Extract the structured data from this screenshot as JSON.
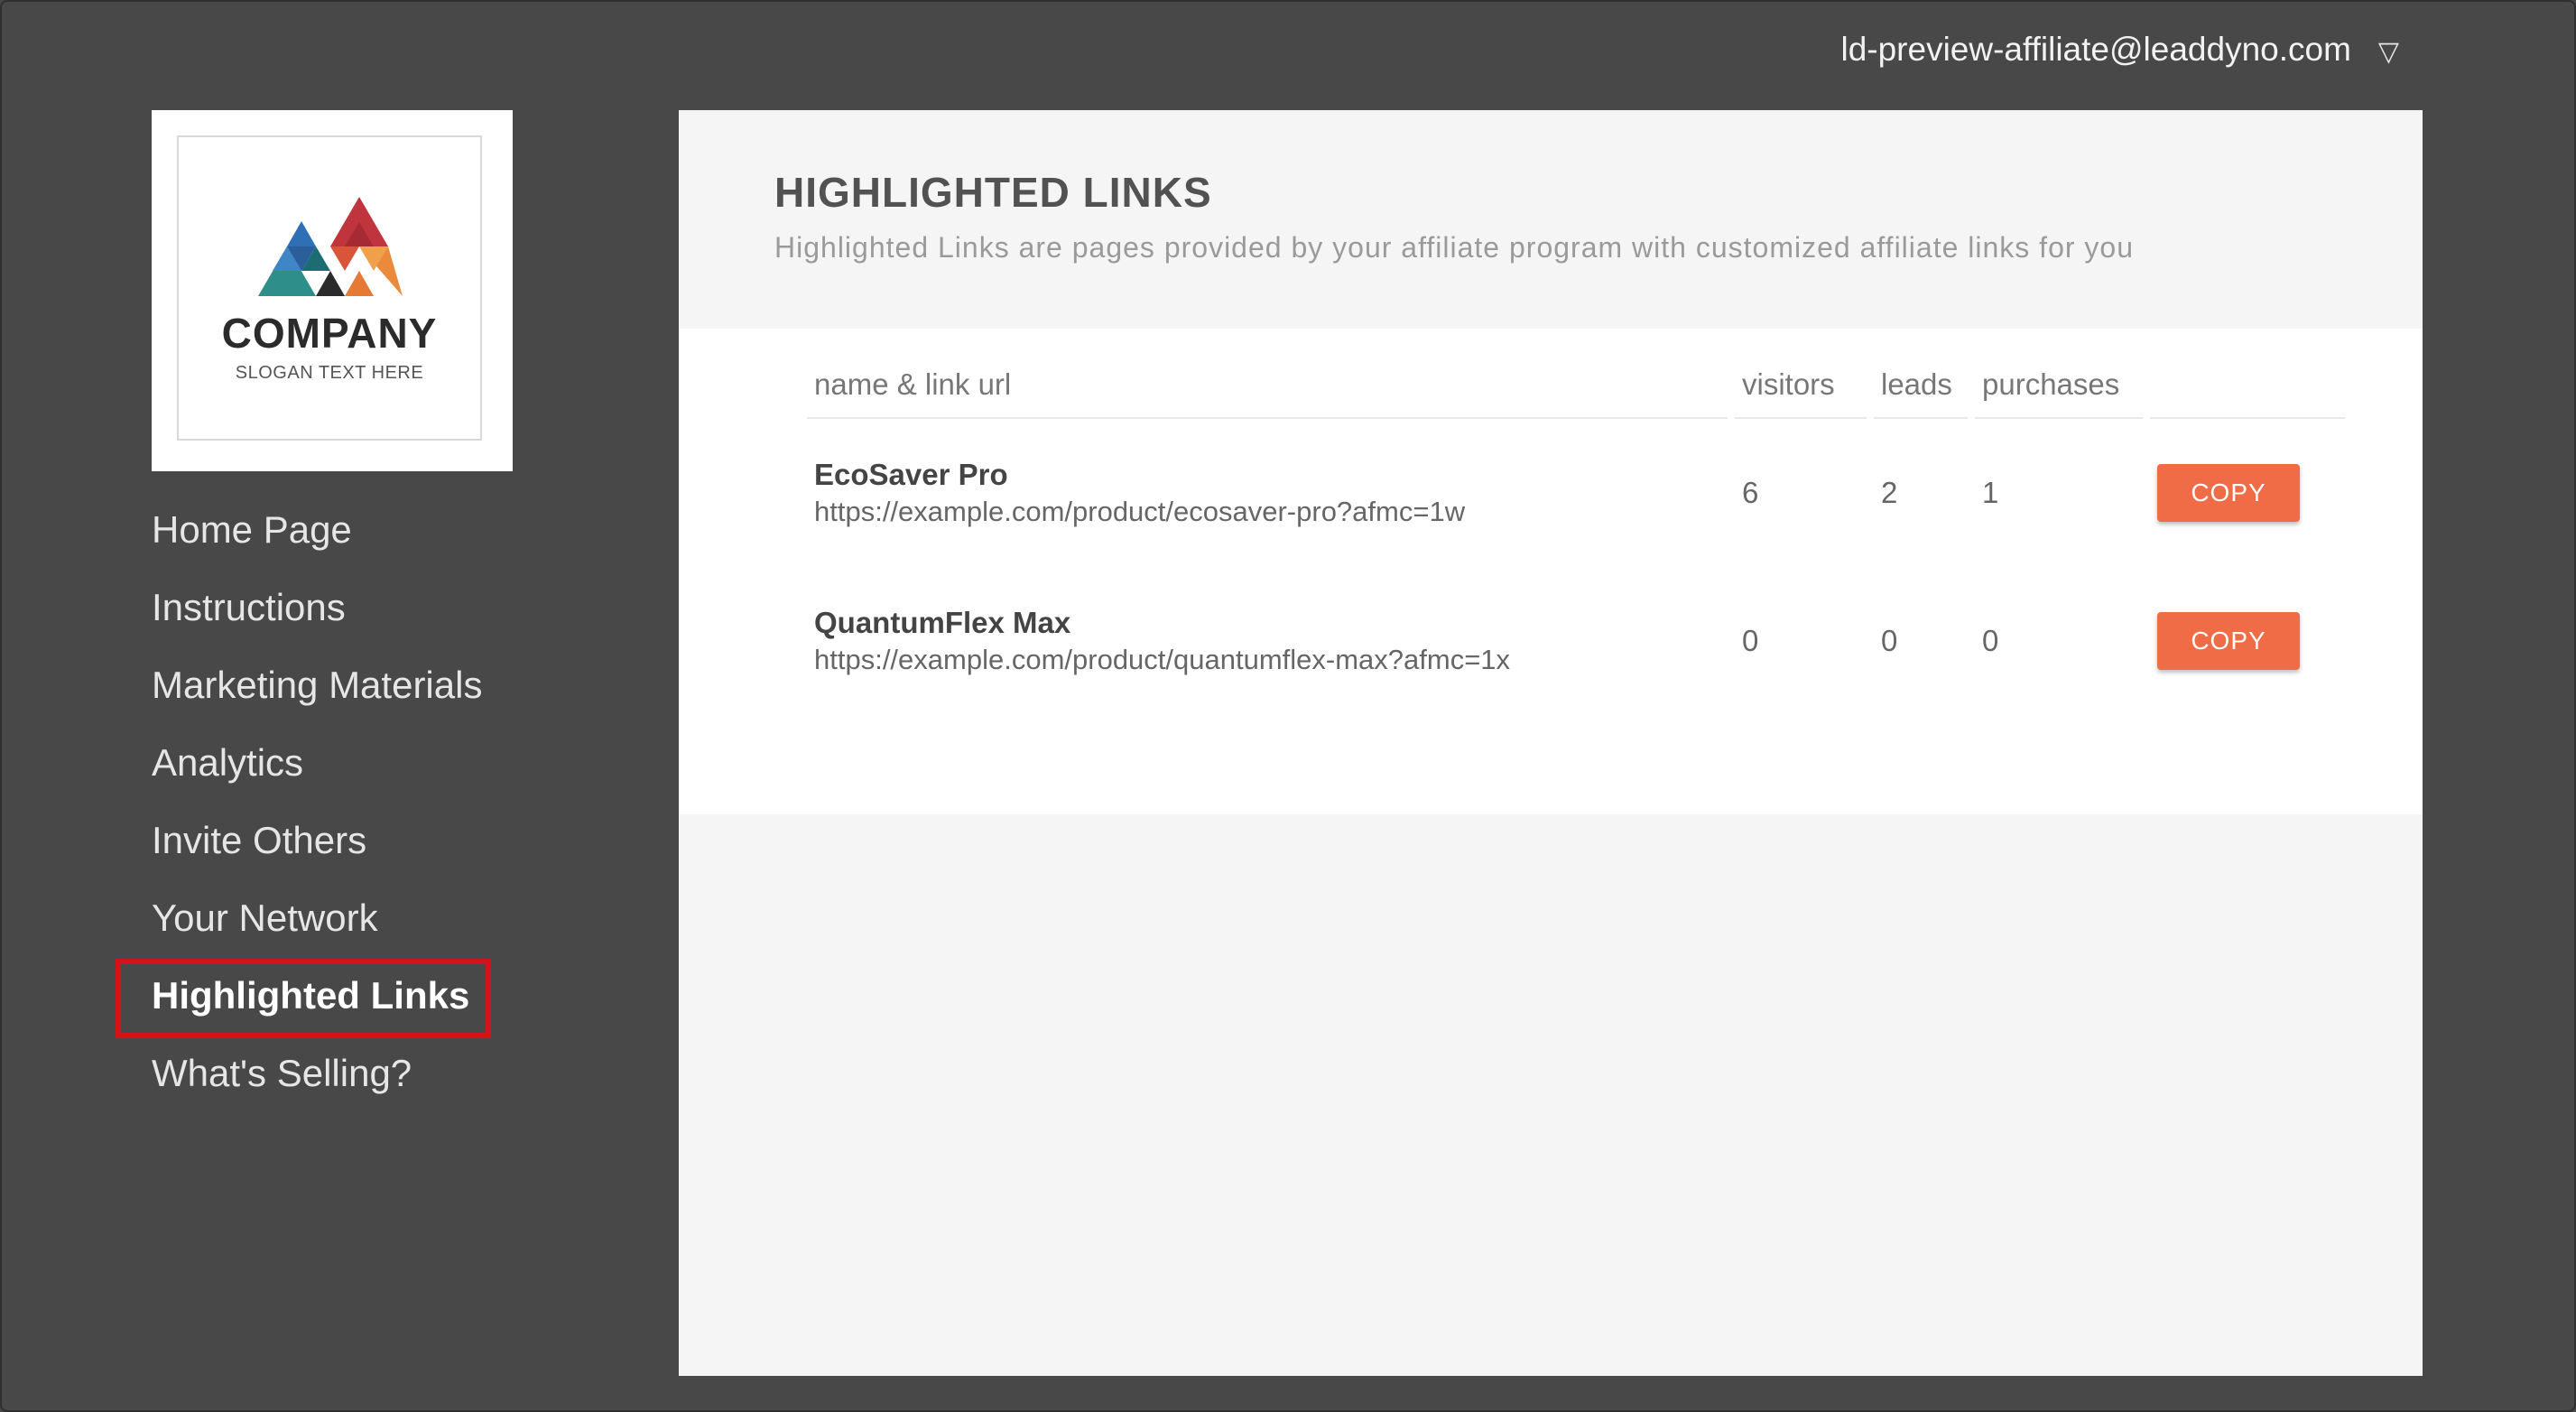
{
  "header": {
    "user_email": "ld-preview-affiliate@leaddyno.com",
    "caret_icon": "caret-down-icon"
  },
  "logo": {
    "name": "COMPANY",
    "slogan": "SLOGAN TEXT HERE",
    "colors": {
      "red": "#c0343d",
      "blue": "#2f6fb4",
      "teal": "#2e8f8a",
      "orange": "#eb8a3a",
      "dark": "#2b2b2b"
    }
  },
  "sidebar": {
    "items": [
      {
        "label": "Home Page"
      },
      {
        "label": "Instructions"
      },
      {
        "label": "Marketing Materials"
      },
      {
        "label": "Analytics"
      },
      {
        "label": "Invite Others"
      },
      {
        "label": "Your Network"
      },
      {
        "label": "Highlighted Links",
        "active": true
      },
      {
        "label": "What's Selling?"
      }
    ]
  },
  "main": {
    "title": "HIGHLIGHTED LINKS",
    "subtitle": "Highlighted Links are pages provided by your affiliate program with customized affiliate links for you",
    "table": {
      "columns": [
        "name & link url",
        "visitors",
        "leads",
        "purchases",
        ""
      ],
      "rows": [
        {
          "name": "EcoSaver Pro",
          "url": "https://example.com/product/ecosaver-pro?afmc=1w",
          "visitors": "6",
          "leads": "2",
          "purchases": "1",
          "action": "COPY"
        },
        {
          "name": "QuantumFlex Max",
          "url": "https://example.com/product/quantumflex-max?afmc=1x",
          "visitors": "0",
          "leads": "0",
          "purchases": "0",
          "action": "COPY"
        }
      ]
    }
  },
  "colors": {
    "background": "#484848",
    "panel": "#f5f5f5",
    "copy_button": "#ef6c47",
    "active_outline": "#d5121a"
  }
}
